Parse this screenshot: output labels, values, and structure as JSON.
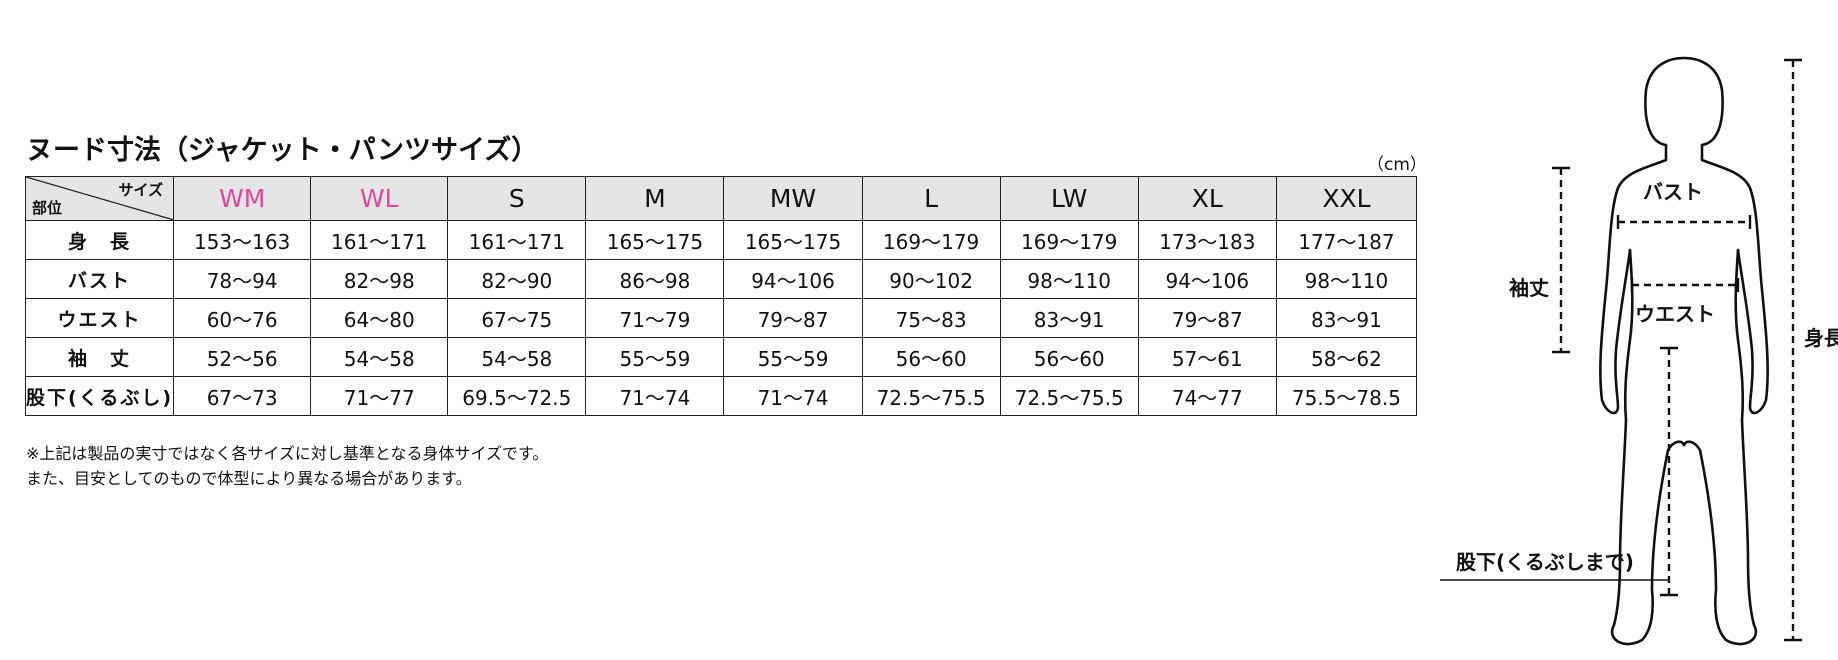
{
  "title": "ヌード寸法（ジャケット・パンツサイズ）",
  "unit": "（cm）",
  "table": {
    "corner_top": "サイズ",
    "corner_bottom": "部位",
    "sizes": [
      "WM",
      "WL",
      "S",
      "M",
      "MW",
      "L",
      "LW",
      "XL",
      "XXL"
    ],
    "highlight_color": "#e0479b",
    "rows": [
      {
        "label": "身　長",
        "values": [
          "153〜163",
          "161〜171",
          "161〜171",
          "165〜175",
          "165〜175",
          "169〜179",
          "169〜179",
          "173〜183",
          "177〜187"
        ]
      },
      {
        "label": "バスト",
        "values": [
          "78〜94",
          "82〜98",
          "82〜90",
          "86〜98",
          "94〜106",
          "90〜102",
          "98〜110",
          "94〜106",
          "98〜110"
        ]
      },
      {
        "label": "ウエスト",
        "values": [
          "60〜76",
          "64〜80",
          "67〜75",
          "71〜79",
          "79〜87",
          "75〜83",
          "83〜91",
          "79〜87",
          "83〜91"
        ]
      },
      {
        "label": "袖　丈",
        "values": [
          "52〜56",
          "54〜58",
          "54〜58",
          "55〜59",
          "55〜59",
          "56〜60",
          "56〜60",
          "57〜61",
          "58〜62"
        ]
      },
      {
        "label": "股下(くるぶし)",
        "values": [
          "67〜73",
          "71〜77",
          "69.5〜72.5",
          "71〜74",
          "71〜74",
          "72.5〜75.5",
          "72.5〜75.5",
          "74〜77",
          "75.5〜78.5"
        ]
      }
    ]
  },
  "notes": [
    "※上記は製品の実寸ではなく各サイズに対し基準となる身体サイズです。",
    "また、目安としてのもので体型により異なる場合があります。"
  ],
  "figure": {
    "bust": "バスト",
    "sleeve": "袖丈",
    "waist": "ウエスト",
    "height": "身長",
    "inseam": "股下(くるぶしまで)"
  }
}
